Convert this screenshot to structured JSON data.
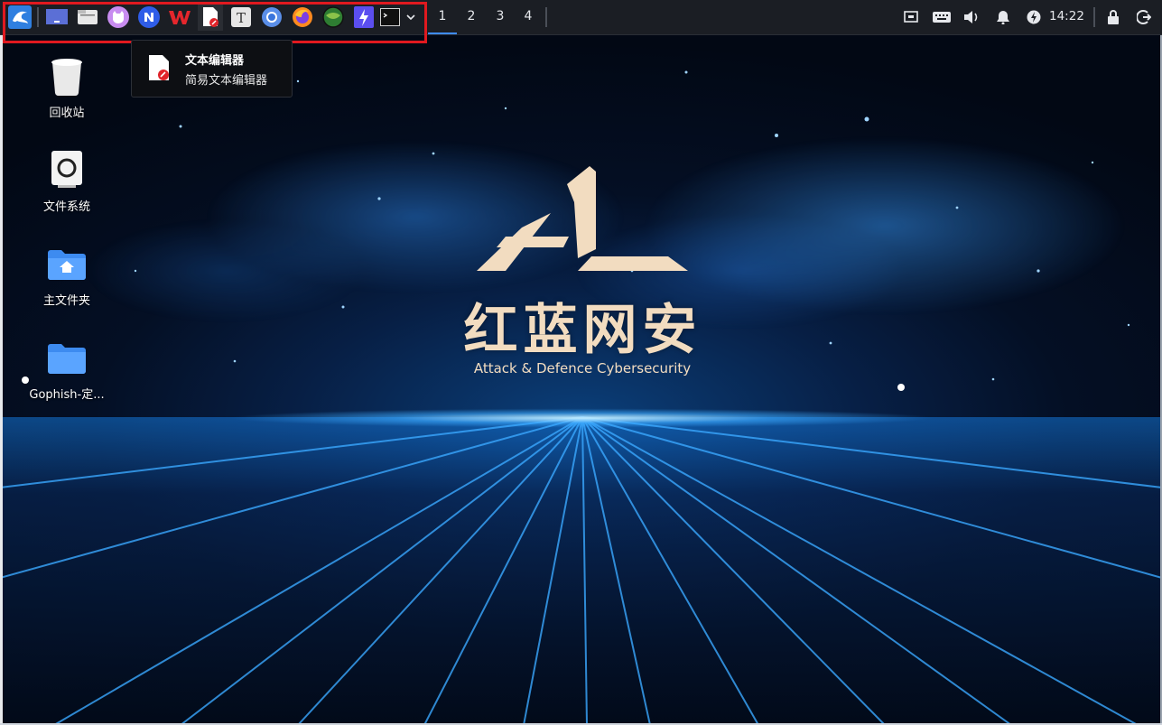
{
  "taskbar": {
    "launcher_icon": "kali-dragon-icon",
    "apps": [
      {
        "name": "show-desktop",
        "icon": "desktop-icon"
      },
      {
        "name": "file-manager",
        "icon": "folder-icon"
      },
      {
        "name": "cat-app",
        "icon": "cat-icon"
      },
      {
        "name": "n-browser",
        "icon": "n-icon"
      },
      {
        "name": "wps-office",
        "icon": "wps-icon"
      },
      {
        "name": "text-editor",
        "icon": "text-editor-icon"
      },
      {
        "name": "typora",
        "icon": "t-icon"
      },
      {
        "name": "chromium",
        "icon": "chromium-icon"
      },
      {
        "name": "firefox",
        "icon": "firefox-icon"
      },
      {
        "name": "globe-tool",
        "icon": "globe-icon"
      },
      {
        "name": "bolt-tool",
        "icon": "bolt-icon"
      },
      {
        "name": "terminal",
        "icon": "terminal-icon"
      }
    ],
    "workspaces": [
      "1",
      "2",
      "3",
      "4"
    ],
    "active_workspace": "1",
    "clock": "14:22",
    "highlight_color": "#e0191f"
  },
  "tooltip": {
    "title": "文本编辑器",
    "subtitle": "简易文本编辑器"
  },
  "desktop": {
    "icons": [
      {
        "label": "回收站",
        "icon": "trash-icon"
      },
      {
        "label": "文件系统",
        "icon": "drive-icon"
      },
      {
        "label": "主文件夹",
        "icon": "home-folder-icon"
      },
      {
        "label": "Gophish-定...",
        "icon": "folder-icon"
      }
    ]
  },
  "wallpaper": {
    "title_cn": "红蓝网安",
    "title_en": "Attack & Defence Cybersecurity",
    "logo_color": "#f2dcc0"
  }
}
